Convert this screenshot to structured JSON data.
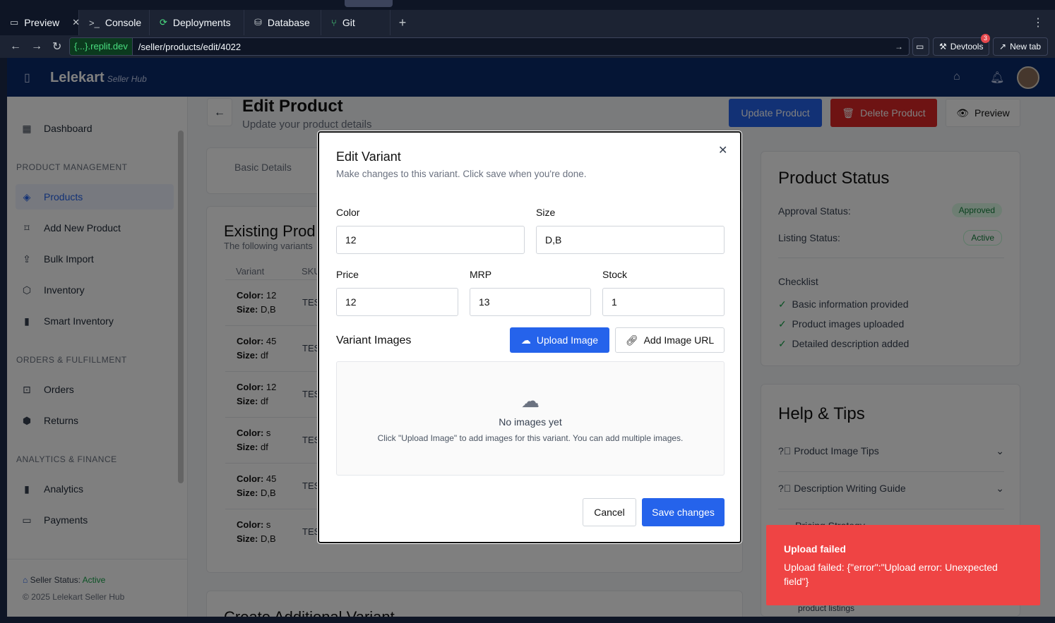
{
  "ide": {
    "tabs": [
      {
        "label": "Preview",
        "icon": "monitor-icon",
        "glyph": "▭"
      },
      {
        "label": "Console",
        "icon": "terminal-icon",
        "glyph": ">_"
      },
      {
        "label": "Deployments",
        "icon": "deploy-icon",
        "glyph": "⟳"
      },
      {
        "label": "Database",
        "icon": "database-icon",
        "glyph": "⛁"
      },
      {
        "label": "Git",
        "icon": "git-icon",
        "glyph": "⑂"
      }
    ],
    "url_host": "{...}.replit.dev",
    "url_path": "/seller/products/edit/4022",
    "devtools_label": "Devtools",
    "devtools_badge": "3",
    "newtab_label": "New tab"
  },
  "app": {
    "brand": "Lelekart",
    "brand_sub": "Seller Hub",
    "sidebar": {
      "sections": [
        "PRODUCT MANAGEMENT",
        "ORDERS & FULFILLMENT",
        "ANALYTICS & FINANCE"
      ],
      "items": [
        {
          "label": "Dashboard",
          "icon": "grid-icon",
          "glyph": "▦"
        },
        {
          "label": "Products",
          "icon": "layers-icon",
          "glyph": "◈"
        },
        {
          "label": "Add New Product",
          "icon": "bookmark-icon",
          "glyph": "⌑"
        },
        {
          "label": "Bulk Import",
          "icon": "upload-icon",
          "glyph": "⇪"
        },
        {
          "label": "Inventory",
          "icon": "box-icon",
          "glyph": "⬡"
        },
        {
          "label": "Smart Inventory",
          "icon": "bar-chart-icon",
          "glyph": "▮"
        },
        {
          "label": "Orders",
          "icon": "bag-icon",
          "glyph": "⊡"
        },
        {
          "label": "Returns",
          "icon": "package-icon",
          "glyph": "⬢"
        },
        {
          "label": "Analytics",
          "icon": "analytics-icon",
          "glyph": "▮"
        },
        {
          "label": "Payments",
          "icon": "card-icon",
          "glyph": "▭"
        }
      ],
      "seller_status_label": "Seller Status:",
      "seller_status_value": "Active",
      "copyright": "© 2025 Lelekart Seller Hub"
    },
    "page": {
      "title": "Edit Product",
      "subtitle": "Update your product details",
      "update_button": "Update Product",
      "delete_button": "Delete Product",
      "preview_button": "Preview",
      "tab_basic": "Basic Details",
      "existing_title": "Existing Prod",
      "existing_sub": "The following variants",
      "col_variant": "Variant",
      "col_sku": "SKU",
      "rows": [
        {
          "color": "12",
          "size": "D,B",
          "sku": "TES"
        },
        {
          "color": "45",
          "size": "df",
          "sku": "TES"
        },
        {
          "color": "12",
          "size": "df",
          "sku": "TES"
        },
        {
          "color": "s",
          "size": "df",
          "sku": "TES"
        },
        {
          "color": "45",
          "size": "D,B",
          "sku": "TES"
        },
        {
          "color": "s",
          "size": "D,B",
          "sku": "TES"
        }
      ],
      "color_label": "Color:",
      "size_label": "Size:",
      "create_additional": "Create Additional Variant"
    },
    "status_card": {
      "title": "Product Status",
      "approval_label": "Approval Status:",
      "approval_value": "Approved",
      "listing_label": "Listing Status:",
      "listing_value": "Active",
      "checklist_title": "Checklist",
      "checklist": [
        "Basic information provided",
        "Product images uploaded",
        "Detailed description added"
      ]
    },
    "help_card": {
      "title": "Help & Tips",
      "items": [
        "Product Image Tips",
        "Description Writing Guide"
      ],
      "partial_item": "Pricing Strategy",
      "partial_footer": "product listings"
    }
  },
  "dialog": {
    "title": "Edit Variant",
    "description": "Make changes to this variant. Click save when you're done.",
    "color_label": "Color",
    "color_value": "12",
    "size_label": "Size",
    "size_value": "D,B",
    "price_label": "Price",
    "price_value": "12",
    "mrp_label": "MRP",
    "mrp_value": "13",
    "stock_label": "Stock",
    "stock_value": "1",
    "images_title": "Variant Images",
    "upload_button": "Upload Image",
    "add_url_button": "Add Image URL",
    "empty_title": "No images yet",
    "empty_hint": "Click \"Upload Image\" to add images for this variant. You can add multiple images.",
    "cancel_button": "Cancel",
    "save_button": "Save changes"
  },
  "toast": {
    "title": "Upload failed",
    "message": "Upload failed: {\"error\":\"Upload error: Unexpected field\"}"
  },
  "colors": {
    "primary": "#2563eb",
    "danger": "#ef4444",
    "header": "#0b2a6b",
    "success": "#16a34a"
  }
}
